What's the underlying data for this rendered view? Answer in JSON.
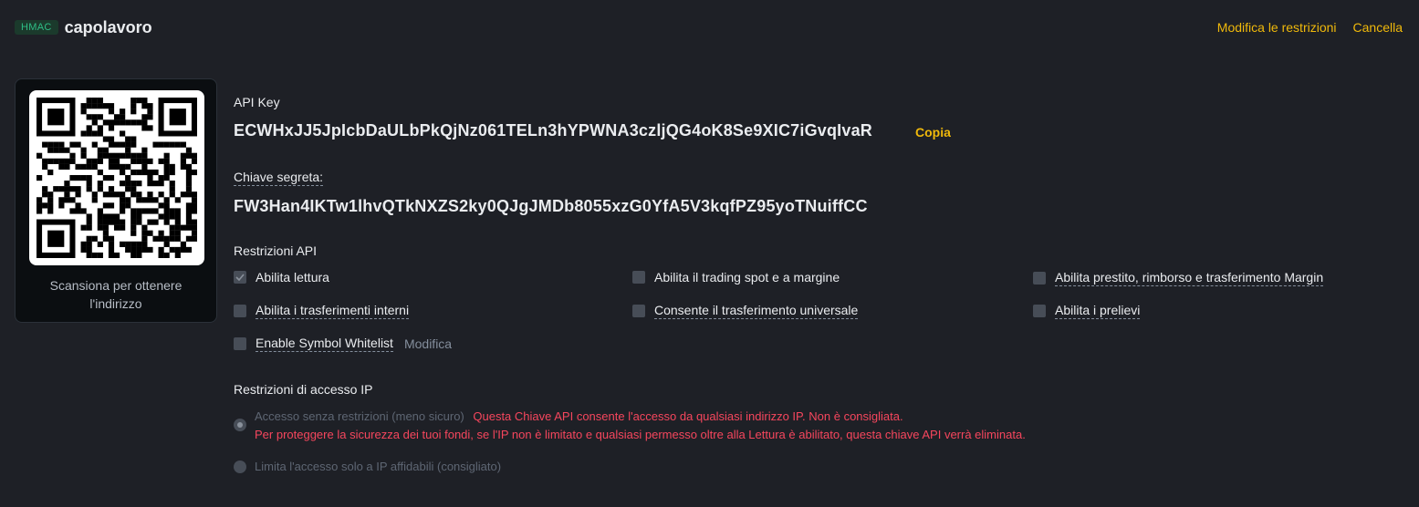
{
  "header": {
    "badge": "HMAC",
    "title": "capolavoro",
    "edit_label": "Modifica le restrizioni",
    "delete_label": "Cancella"
  },
  "qr": {
    "caption": "Scansiona per ottenere l'indirizzo"
  },
  "api_key": {
    "label": "API Key",
    "value": "ECWHxJJ5JpIcbDaULbPkQjNz061TELn3hYPWNA3czljQG4oK8Se9XIC7iGvqIvaR",
    "copy_label": "Copia"
  },
  "secret": {
    "label": "Chiave segreta:",
    "value": "FW3Han4IKTw1lhvQTkNXZS2ky0QJgJMDb8055xzG0YfA5V3kqfPZ95yoTNuiffCC"
  },
  "restrictions": {
    "title": "Restrizioni API",
    "items": [
      {
        "label": "Abilita lettura",
        "checked": true
      },
      {
        "label": "Abilita il trading spot e a margine",
        "checked": false
      },
      {
        "label": "Abilita prestito, rimborso e trasferimento Margin",
        "checked": false
      },
      {
        "label": "Abilita i trasferimenti interni",
        "checked": false
      },
      {
        "label": "Consente il trasferimento universale",
        "checked": false
      },
      {
        "label": "Abilita i prelievi",
        "checked": false
      },
      {
        "label": "Enable Symbol Whitelist",
        "checked": false
      }
    ],
    "whitelist_edit": "Modifica"
  },
  "ip": {
    "title": "Restrizioni di accesso IP",
    "unrestricted_label": "Accesso senza restrizioni (meno sicuro)",
    "warning_line1": "Questa Chiave API consente l'accesso da qualsiasi indirizzo IP. Non è consigliata.",
    "warning_line2": "Per proteggere la sicurezza dei tuoi fondi, se l'IP non è limitato e qualsiasi permesso oltre alla Lettura è abilitato, questa chiave API verrà eliminata.",
    "trusted_label": "Limita l'accesso solo a IP affidabili (consigliato)",
    "selected": "unrestricted"
  },
  "colors": {
    "background": "#1e2026",
    "accent": "#f0b90b",
    "warning": "#f6465d",
    "badge": "#2ebd85"
  }
}
